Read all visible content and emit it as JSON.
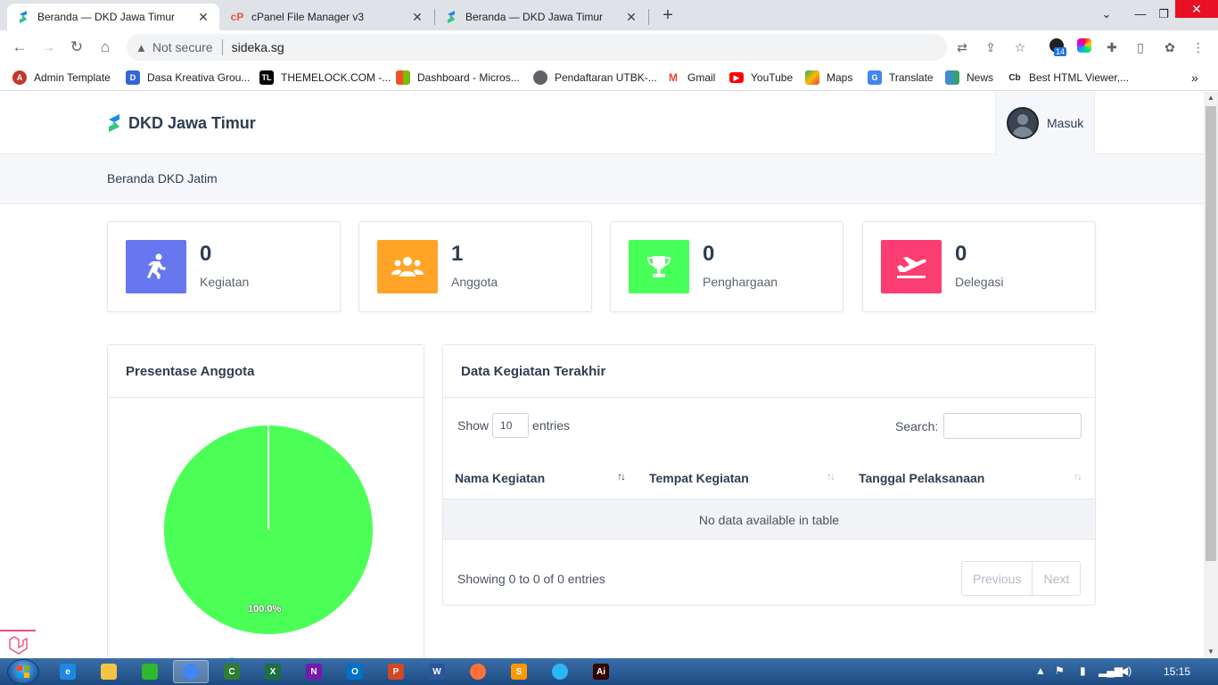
{
  "browser": {
    "tabs": [
      {
        "title": "Beranda — DKD Jawa Timur",
        "active": true,
        "favicon": "dkd-logo-icon"
      },
      {
        "title": "cPanel File Manager v3",
        "active": false,
        "favicon": "cpanel-icon"
      },
      {
        "title": "Beranda — DKD Jawa Timur",
        "active": false,
        "favicon": "dkd-logo-icon"
      }
    ],
    "security_label": "Not secure",
    "url": "sideka.sg",
    "extension_badge": "14",
    "bookmarks": [
      {
        "label": "Admin Template",
        "icon": "admin-template-icon",
        "color": "#c0392b"
      },
      {
        "label": "Dasa Kreativa Grou...",
        "icon": "dasa-kreativa-icon",
        "color": "#3367d6"
      },
      {
        "label": "THEMELOCK.COM -...",
        "icon": "themelock-icon",
        "color": "#000000"
      },
      {
        "label": "Dashboard - Micros...",
        "icon": "microsoft-icon",
        "color": "#f25022"
      },
      {
        "label": "Pendaftaran UTBK-...",
        "icon": "globe-icon",
        "color": "#5f6368"
      },
      {
        "label": "Gmail",
        "icon": "gmail-icon",
        "color": "#ea4335"
      },
      {
        "label": "YouTube",
        "icon": "youtube-icon",
        "color": "#ff0000"
      },
      {
        "label": "Maps",
        "icon": "maps-icon",
        "color": "#34a853"
      },
      {
        "label": "Translate",
        "icon": "translate-icon",
        "color": "#4285f4"
      },
      {
        "label": "News",
        "icon": "news-icon",
        "color": "#4285f4"
      },
      {
        "label": "Best HTML Viewer,...",
        "icon": "codebeautify-icon",
        "color": "#222222"
      }
    ]
  },
  "site": {
    "brand": "DKD Jawa Timur",
    "login_label": "Masuk",
    "breadcrumb": "Beranda DKD Jatim",
    "stats": [
      {
        "value": "0",
        "label": "Kegiatan",
        "icon": "running-person-icon",
        "color": "#6777ef"
      },
      {
        "value": "1",
        "label": "Anggota",
        "icon": "users-group-icon",
        "color": "#ffa426"
      },
      {
        "value": "0",
        "label": "Penghargaan",
        "icon": "trophy-icon",
        "color": "#47ff57"
      },
      {
        "value": "0",
        "label": "Delegasi",
        "icon": "plane-departure-icon",
        "color": "#fc3d72"
      }
    ],
    "members_panel": {
      "title": "Presentase Anggota",
      "pie_label": "100.0%"
    },
    "activities_panel": {
      "title": "Data Kegiatan Terakhir",
      "show_label": "Show",
      "entries_label": "entries",
      "page_length": "10",
      "search_label": "Search:",
      "columns": [
        "Nama Kegiatan",
        "Tempat Kegiatan",
        "Tanggal Pelaksanaan"
      ],
      "empty_text": "No data available in table",
      "info_text": "Showing 0 to 0 of 0 entries",
      "prev_label": "Previous",
      "next_label": "Next"
    }
  },
  "chart_data": {
    "type": "pie",
    "title": "",
    "labels": [
      ""
    ],
    "values": [
      100.0
    ],
    "colors": [
      "#4cff57"
    ],
    "data_labels": [
      "100.0%"
    ]
  },
  "taskbar": {
    "apps": [
      {
        "icon": "internet-explorer-icon",
        "color": "#1e88e5",
        "glyph": "e"
      },
      {
        "icon": "file-explorer-icon",
        "color": "#f4c542",
        "glyph": ""
      },
      {
        "icon": "green-app-icon",
        "color": "#2eb82e",
        "glyph": ""
      },
      {
        "icon": "chrome-icon",
        "color": "#4285f4",
        "glyph": ""
      },
      {
        "icon": "camtasia-icon",
        "color": "#2e7d32",
        "glyph": "C"
      },
      {
        "icon": "excel-icon",
        "color": "#1d6f42",
        "glyph": "X"
      },
      {
        "icon": "onenote-icon",
        "color": "#7719aa",
        "glyph": "N"
      },
      {
        "icon": "outlook-icon",
        "color": "#0072c6",
        "glyph": "O"
      },
      {
        "icon": "powerpoint-icon",
        "color": "#d24726",
        "glyph": "P"
      },
      {
        "icon": "word-icon",
        "color": "#2b579a",
        "glyph": "W"
      },
      {
        "icon": "firefox-icon",
        "color": "#ff7139",
        "glyph": ""
      },
      {
        "icon": "sublime-text-icon",
        "color": "#ff9800",
        "glyph": "S"
      },
      {
        "icon": "world-app-icon",
        "color": "#29b6f6",
        "glyph": ""
      },
      {
        "icon": "illustrator-icon",
        "color": "#330000",
        "glyph": "Ai"
      }
    ],
    "clock": "15:15"
  }
}
